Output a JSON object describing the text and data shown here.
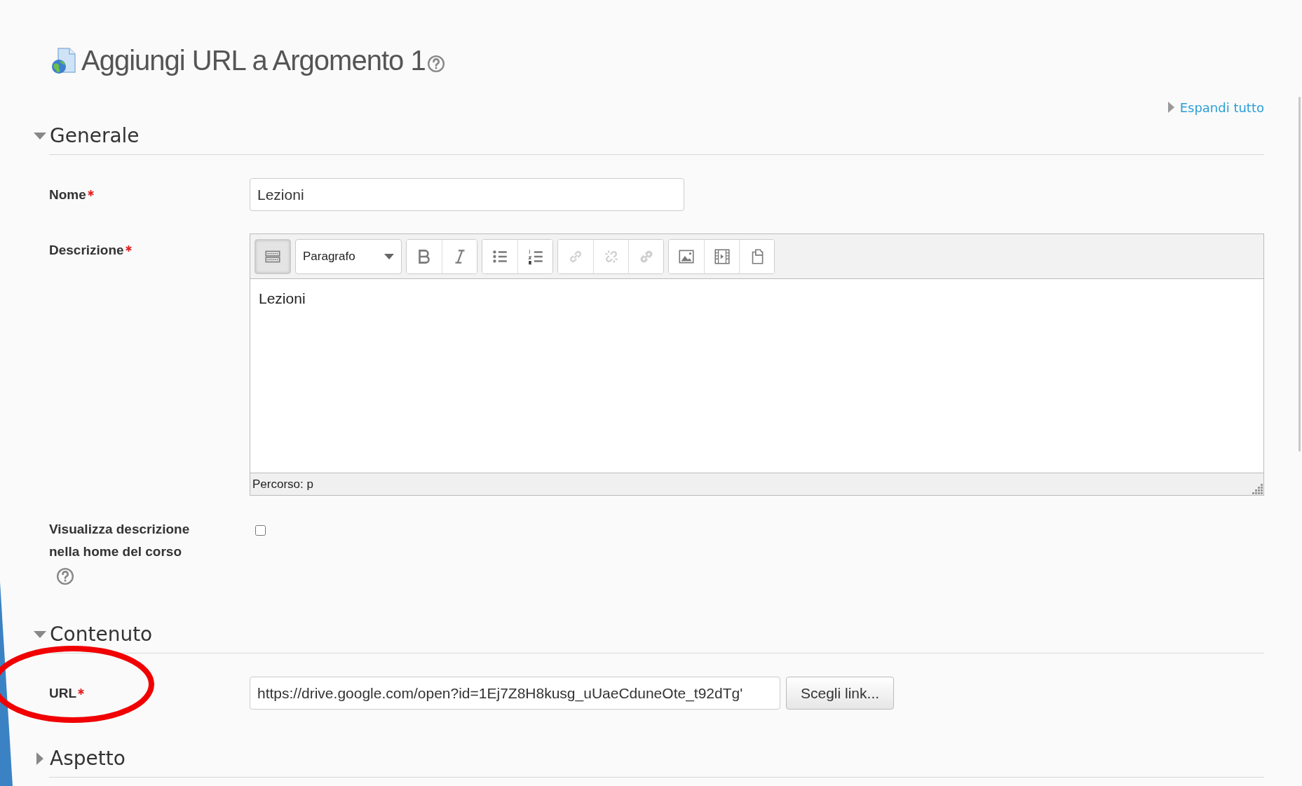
{
  "page_title": "Aggiungi URL a Argomento 1",
  "expand_all": "Espandi tutto",
  "sections": [
    {
      "title": "Generale",
      "expanded": true,
      "fields": [
        {
          "kind": "text",
          "label": "Nome",
          "required": true,
          "value": "Lezioni"
        },
        {
          "kind": "editor",
          "label": "Descrizione",
          "required": true,
          "toolbar_groups": [
            [
              {
                "kind": "toggle",
                "pressed": true,
                "disabled": false
              }
            ],
            [
              {
                "kind": "select",
                "label": "Paragrafo"
              }
            ],
            [
              {
                "kind": "bold",
                "pressed": false,
                "disabled": false
              },
              {
                "kind": "italic",
                "pressed": false,
                "disabled": false
              }
            ],
            [
              {
                "kind": "bullets",
                "pressed": false,
                "disabled": false
              },
              {
                "kind": "numbers",
                "pressed": false,
                "disabled": false
              }
            ],
            [
              {
                "kind": "link",
                "pressed": false,
                "disabled": true
              },
              {
                "kind": "unlink",
                "pressed": false,
                "disabled": true
              },
              {
                "kind": "anchor",
                "pressed": false,
                "disabled": true
              }
            ],
            [
              {
                "kind": "image",
                "pressed": false,
                "disabled": false
              },
              {
                "kind": "media",
                "pressed": false,
                "disabled": false
              },
              {
                "kind": "paste",
                "pressed": false,
                "disabled": false
              }
            ]
          ],
          "content": "Lezioni",
          "path": "Percorso: p"
        },
        {
          "kind": "checkbox",
          "label_lines": [
            "Visualizza descrizione",
            "nella home del corso"
          ],
          "checked": false,
          "help": true
        }
      ]
    },
    {
      "title": "Contenuto",
      "expanded": true,
      "fields": [
        {
          "kind": "url",
          "label": "URL",
          "required": true,
          "value": "https://drive.google.com/open?id=1Ej7Z8H8kusg_uUaeCduneOte_t92dTg'",
          "button": "Scegli link..."
        }
      ]
    },
    {
      "title": "Aspetto",
      "expanded": false
    }
  ]
}
